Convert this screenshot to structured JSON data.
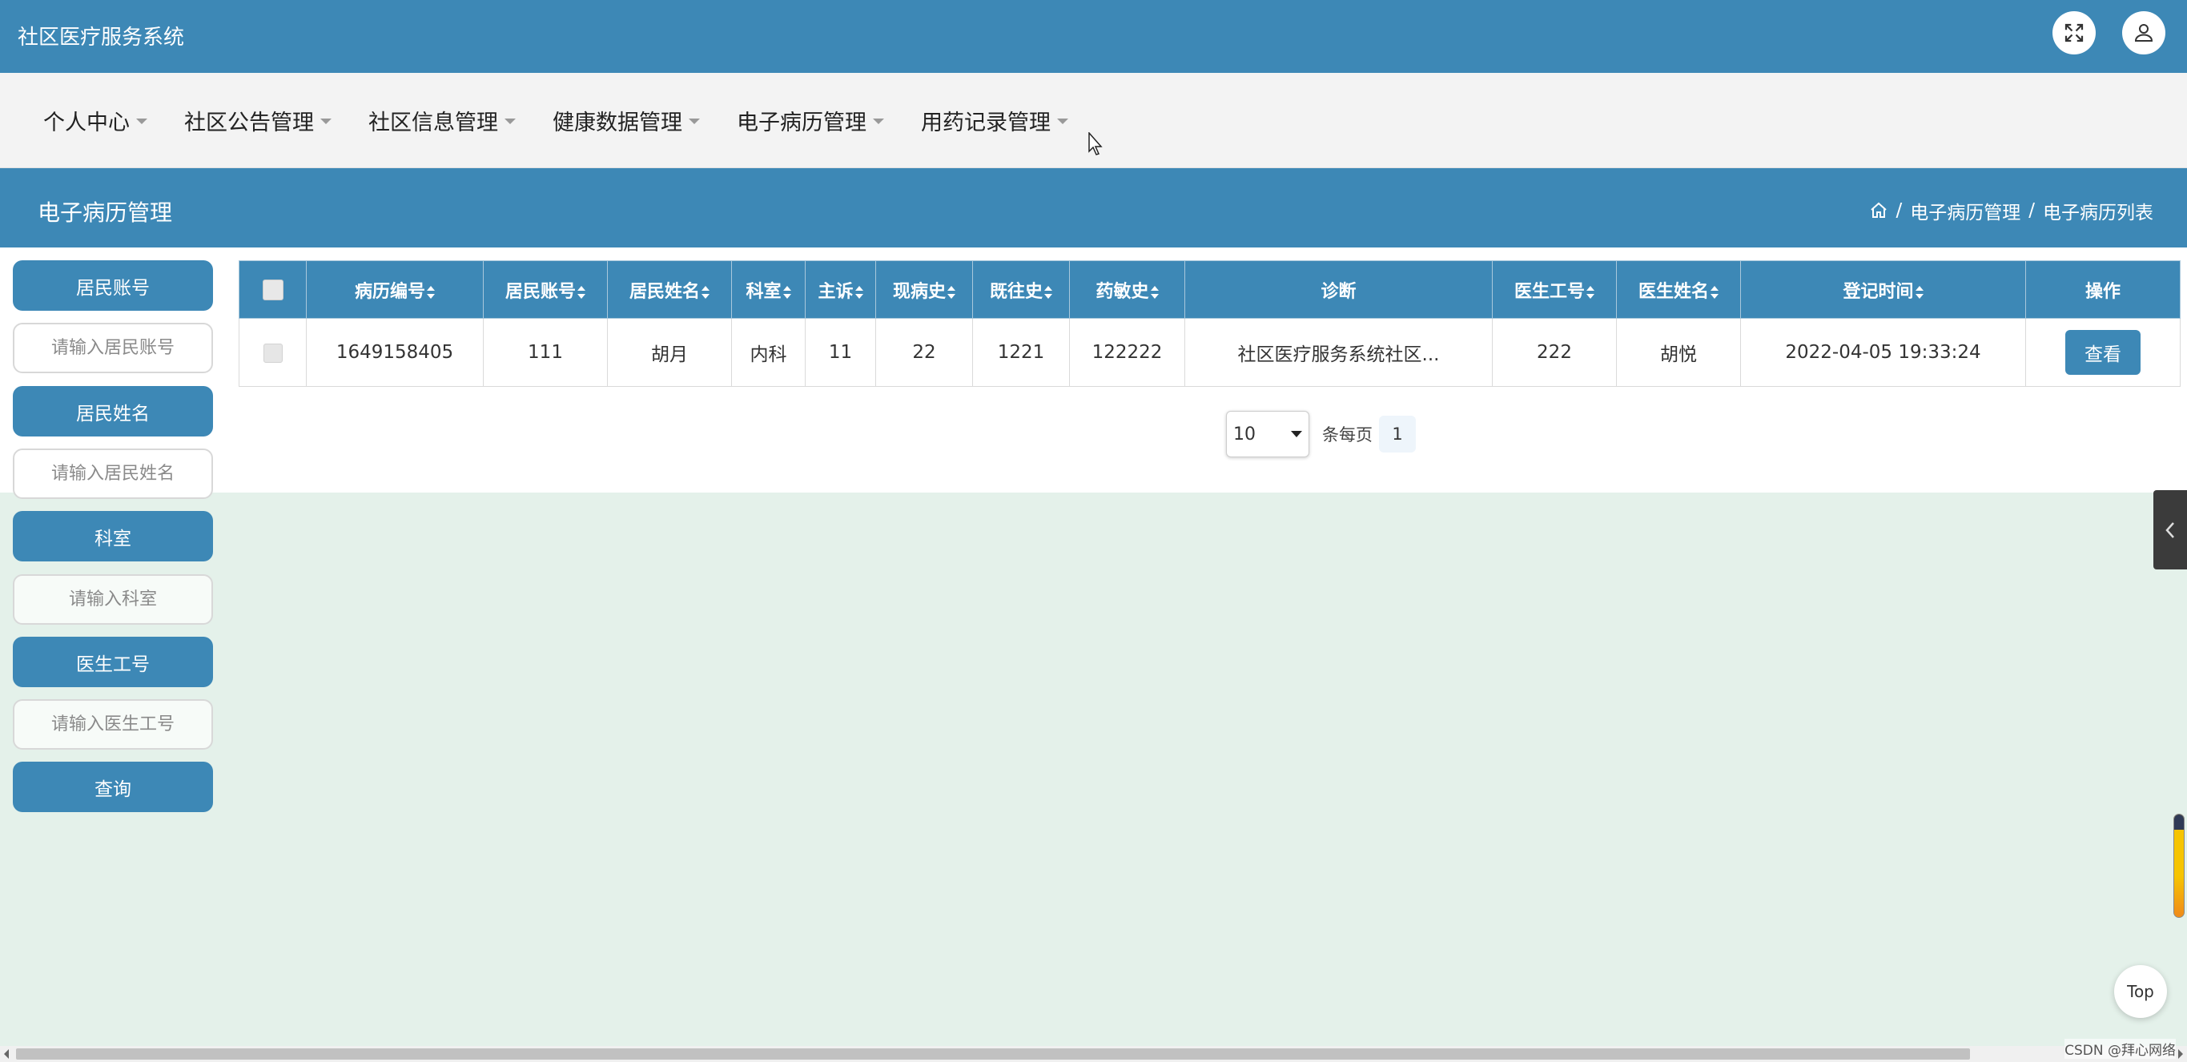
{
  "header": {
    "app_title": "社区医疗服务系统",
    "fullscreen_icon": "fullscreen-icon",
    "user_icon": "user-icon"
  },
  "nav": {
    "items": [
      {
        "label": "个人中心"
      },
      {
        "label": "社区公告管理"
      },
      {
        "label": "社区信息管理"
      },
      {
        "label": "健康数据管理"
      },
      {
        "label": "电子病历管理"
      },
      {
        "label": "用药记录管理"
      }
    ]
  },
  "section": {
    "title": "电子病历管理",
    "breadcrumb": [
      "电子病历管理",
      "电子病历列表"
    ],
    "separator": "/"
  },
  "filters": {
    "resident_account_label": "居民账号",
    "resident_account_placeholder": "请输入居民账号",
    "resident_name_label": "居民姓名",
    "resident_name_placeholder": "请输入居民姓名",
    "department_label": "科室",
    "department_placeholder": "请输入科室",
    "doctor_id_label": "医生工号",
    "doctor_id_placeholder": "请输入医生工号",
    "search_button": "查询"
  },
  "table": {
    "headers": {
      "record_no": "病历编号",
      "resident_account": "居民账号",
      "resident_name": "居民姓名",
      "department": "科室",
      "chief_complaint": "主诉",
      "present_history": "现病史",
      "past_history": "既往史",
      "allergy_history": "药敏史",
      "diagnosis": "诊断",
      "doctor_id": "医生工号",
      "doctor_name": "医生姓名",
      "register_time": "登记时间",
      "actions": "操作"
    },
    "rows": [
      {
        "record_no": "1649158405",
        "resident_account": "111",
        "resident_name": "胡月",
        "department": "内科",
        "chief_complaint": "11",
        "present_history": "22",
        "past_history": "1221",
        "allergy_history": "122222",
        "diagnosis": "社区医疗服务系统社区...",
        "doctor_id": "222",
        "doctor_name": "胡悦",
        "register_time": "2022-04-05 19:33:24",
        "action_label": "查看"
      }
    ]
  },
  "pagination": {
    "page_size": "10",
    "per_page_label": "条每页",
    "current_page": "1"
  },
  "widgets": {
    "top_button": "Top",
    "progress_fraction": 0.15
  },
  "watermark": "CSDN @拜心网络",
  "colors": {
    "primary": "#3d88b6",
    "page_bg": "#e4f1ea",
    "nav_bg": "#f3f3f3"
  }
}
